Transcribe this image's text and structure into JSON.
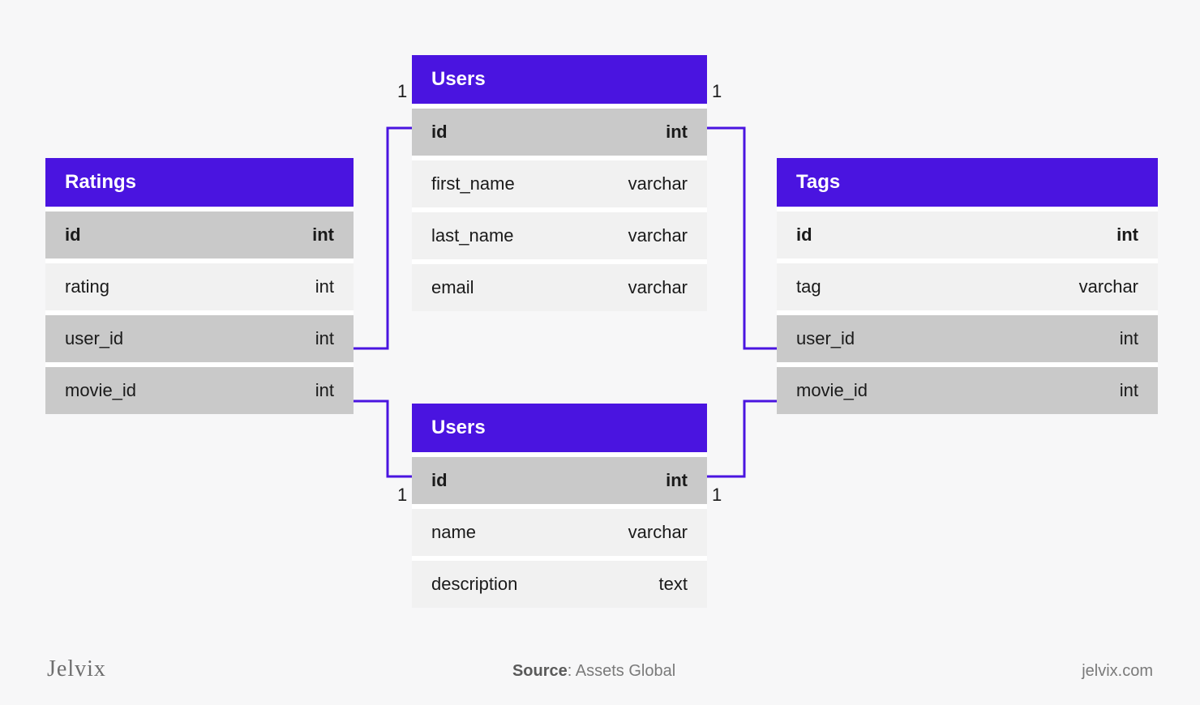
{
  "tables": {
    "ratings": {
      "title": "Ratings",
      "rows": [
        {
          "name": "id",
          "type": "int",
          "pk": true,
          "fk": false,
          "bold": true
        },
        {
          "name": "rating",
          "type": "int",
          "pk": false,
          "fk": false,
          "bold": false
        },
        {
          "name": "user_id",
          "type": "int",
          "pk": false,
          "fk": true,
          "bold": false
        },
        {
          "name": "movie_id",
          "type": "int",
          "pk": false,
          "fk": true,
          "bold": false
        }
      ]
    },
    "users_top": {
      "title": "Users",
      "rows": [
        {
          "name": "id",
          "type": "int",
          "pk": true,
          "fk": false,
          "bold": true
        },
        {
          "name": "first_name",
          "type": "varchar",
          "pk": false,
          "fk": false,
          "bold": false
        },
        {
          "name": "last_name",
          "type": "varchar",
          "pk": false,
          "fk": false,
          "bold": false
        },
        {
          "name": "email",
          "type": "varchar",
          "pk": false,
          "fk": false,
          "bold": false
        }
      ]
    },
    "users_bottom": {
      "title": "Users",
      "rows": [
        {
          "name": "id",
          "type": "int",
          "pk": true,
          "fk": false,
          "bold": true
        },
        {
          "name": "name",
          "type": "varchar",
          "pk": false,
          "fk": false,
          "bold": false
        },
        {
          "name": "description",
          "type": "text",
          "pk": false,
          "fk": false,
          "bold": false
        }
      ]
    },
    "tags": {
      "title": "Tags",
      "rows": [
        {
          "name": "id",
          "type": "int",
          "pk": false,
          "fk": false,
          "bold": true
        },
        {
          "name": "tag",
          "type": "varchar",
          "pk": false,
          "fk": false,
          "bold": false
        },
        {
          "name": "user_id",
          "type": "int",
          "pk": false,
          "fk": true,
          "bold": false
        },
        {
          "name": "movie_id",
          "type": "int",
          "pk": false,
          "fk": true,
          "bold": false
        }
      ]
    }
  },
  "cardinalities": {
    "c1": "1",
    "c2": "1",
    "c3": "1",
    "c4": "1"
  },
  "footer": {
    "logo": "Jelvix",
    "source_label": "Source",
    "source_value": ": Assets Global",
    "url": "jelvix.com"
  },
  "colors": {
    "header": "#4a14e0",
    "stroke": "#4a14e0"
  }
}
